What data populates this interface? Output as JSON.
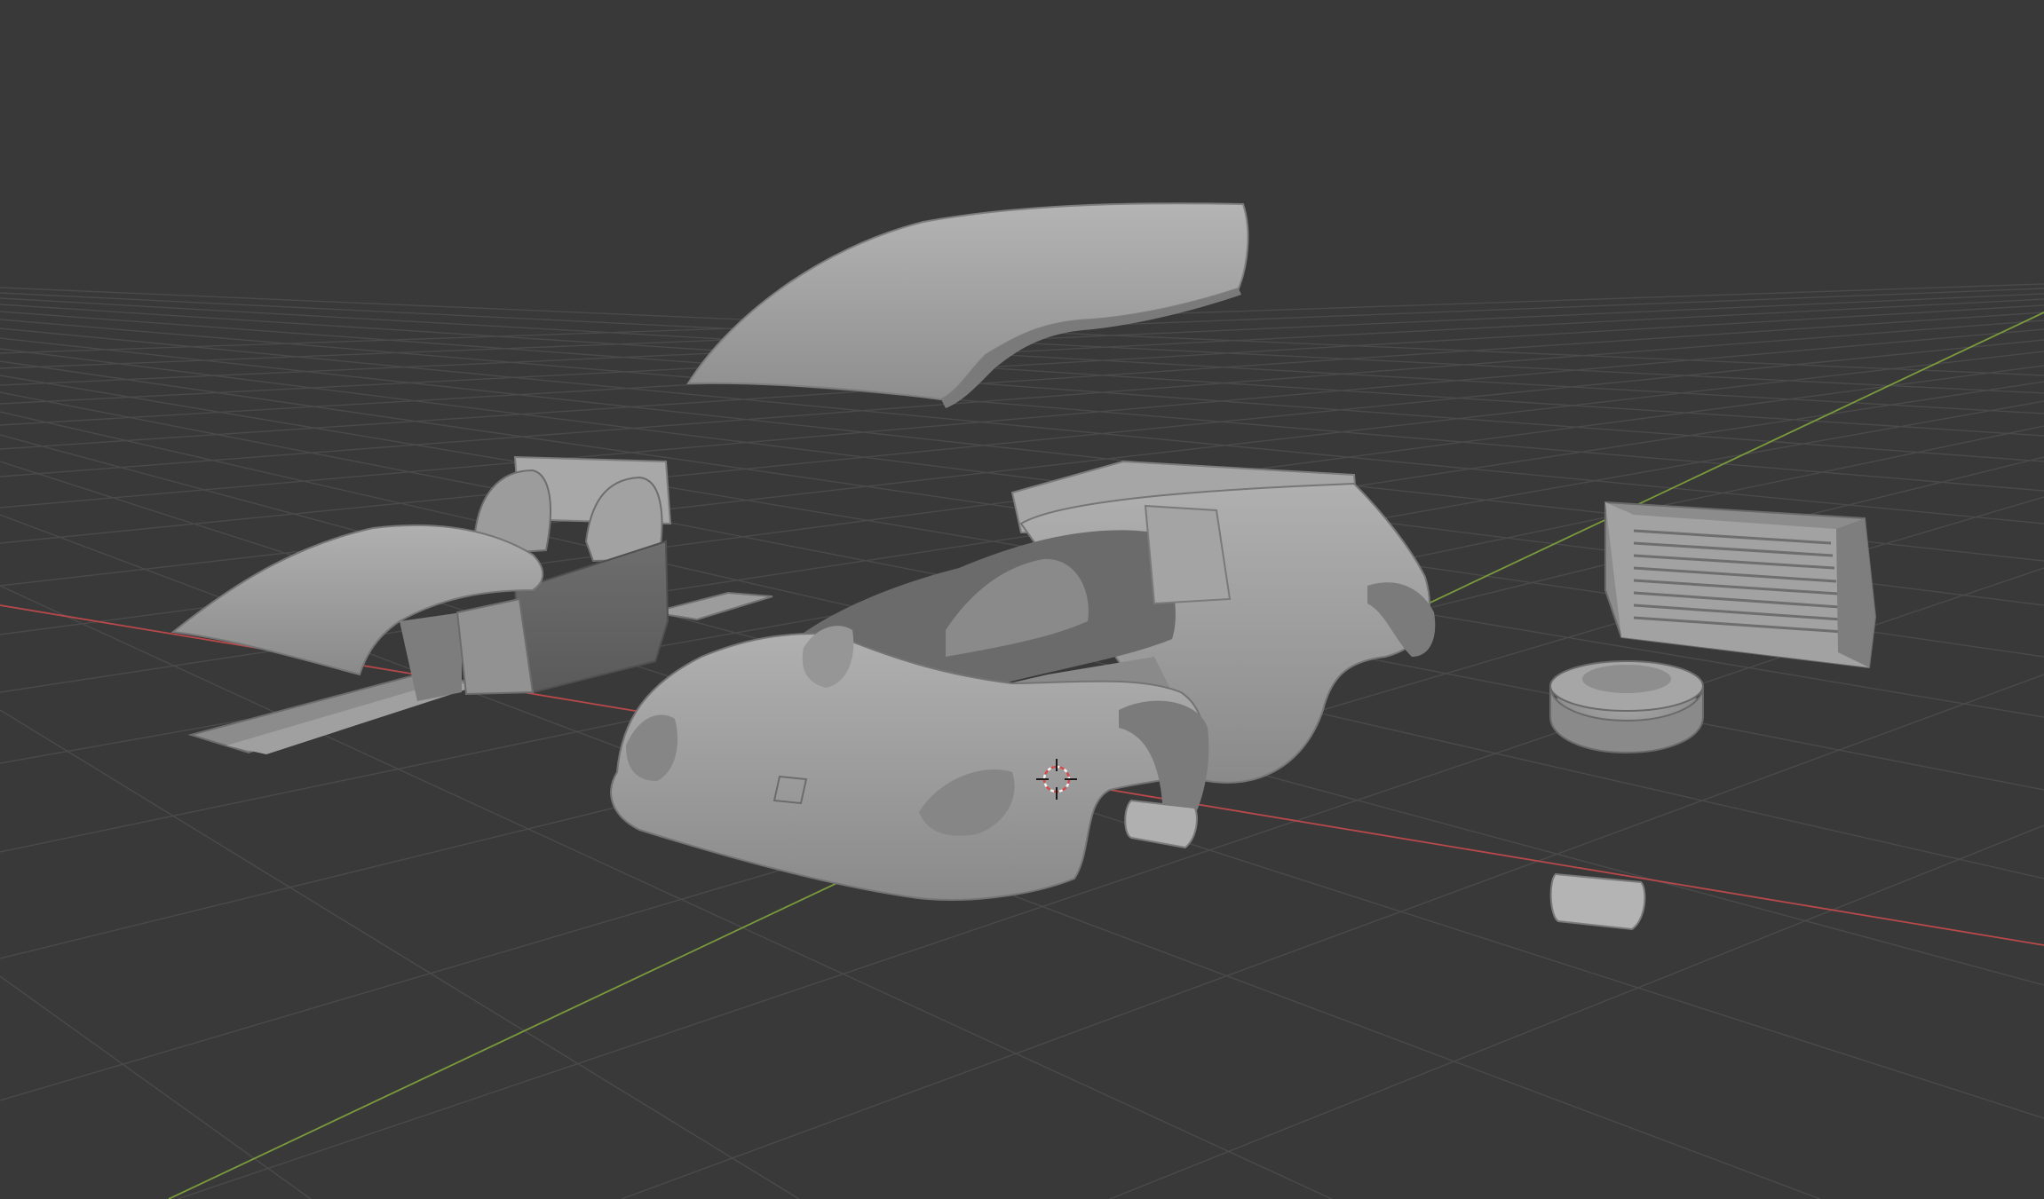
{
  "viewport": {
    "background": "#393939",
    "grid_color": "#4a4a4a",
    "x_axis_color": "#b8494b",
    "y_axis_color": "#7a9a3c",
    "mesh_color": "#9a9a9a"
  },
  "objects": [
    {
      "name": "roof-panel"
    },
    {
      "name": "interior-tub-with-seats"
    },
    {
      "name": "car-body-shell"
    },
    {
      "name": "rear-grille-panel"
    },
    {
      "name": "tire"
    },
    {
      "name": "small-panel-front"
    },
    {
      "name": "small-panel-rear"
    }
  ],
  "cursor_3d": {
    "name": "3d-cursor"
  }
}
